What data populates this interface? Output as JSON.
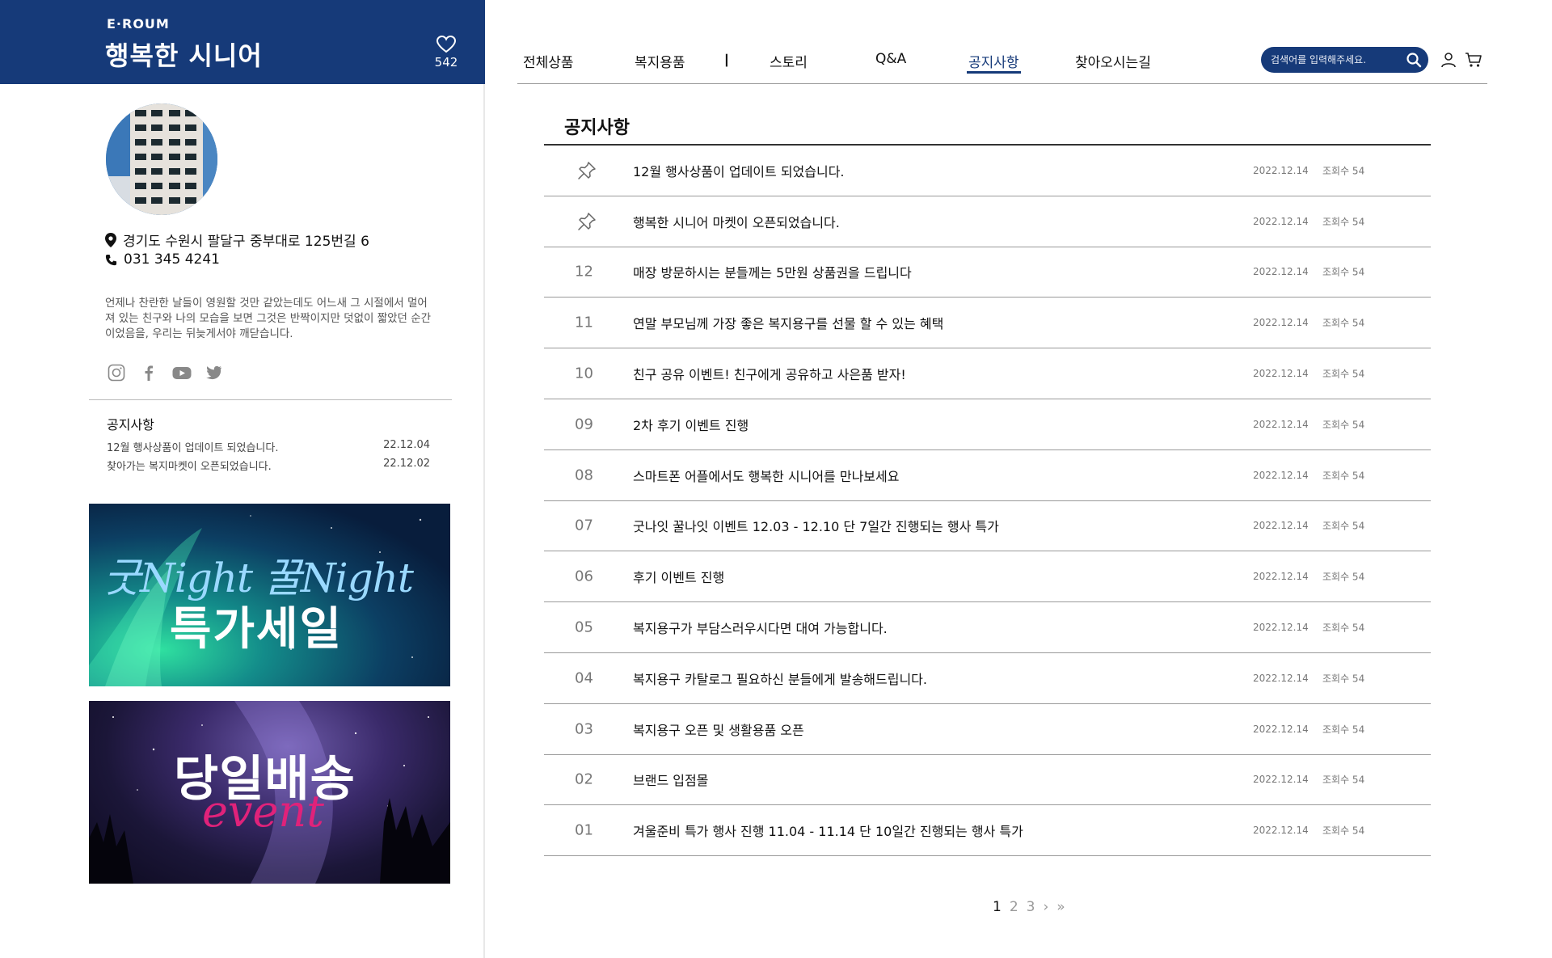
{
  "brand": {
    "logo": "E·ROUM",
    "title": "행복한 시니어",
    "like_count": "542"
  },
  "profile": {
    "address": "경기도 수원시 팔달구 중부대로 125번길 6",
    "phone": "031 345 4241",
    "about": "언제나 찬란한 날들이 영원할 것만 같았는데도 어느새 그 시절에서 멀어져 있는 친구와 나의 모습을 보면 그것은 반짝이지만 덧없이 짧았던 순간이었음을, 우리는 뒤늦게서야 깨닫습니다."
  },
  "side_notice": {
    "title": "공지사항",
    "items": [
      {
        "title": "12월 행사상품이 업데이트 되었습니다.",
        "date": "22.12.04"
      },
      {
        "title": "찾아가는 복지마켓이 오픈되었습니다.",
        "date": "22.12.02"
      }
    ]
  },
  "banners": {
    "night": {
      "script": "굿Night 꿀Night",
      "headline": "특가세일"
    },
    "delivery": {
      "headline": "당일배송",
      "script": "event"
    }
  },
  "nav": {
    "items": [
      "전체상품",
      "복지용품",
      "ㅣ",
      "스토리",
      "Q&A",
      "공지사항",
      "찾아오시는길"
    ],
    "active": "공지사항",
    "search_placeholder": "검색어를 입력해주세요."
  },
  "board": {
    "title": "공지사항",
    "rows": [
      {
        "num": "",
        "pinned": true,
        "title": "12월 행사상품이 업데이트 되었습니다.",
        "date": "2022.12.14",
        "views": "조회수 54"
      },
      {
        "num": "",
        "pinned": true,
        "title": "행복한 시니어 마켓이 오픈되었습니다.",
        "date": "2022.12.14",
        "views": "조회수 54"
      },
      {
        "num": "12",
        "pinned": false,
        "title": "매장 방문하시는 분들께는 5만원 상품권을 드립니다",
        "date": "2022.12.14",
        "views": "조회수 54"
      },
      {
        "num": "11",
        "pinned": false,
        "title": "연말 부모님께 가장 좋은 복지용구를 선물 할 수 있는 혜택",
        "date": "2022.12.14",
        "views": "조회수 54"
      },
      {
        "num": "10",
        "pinned": false,
        "title": "친구 공유 이벤트! 친구에게 공유하고 사은품 받자!",
        "date": "2022.12.14",
        "views": "조회수 54"
      },
      {
        "num": "09",
        "pinned": false,
        "title": "2차 후기 이벤트 진행",
        "date": "2022.12.14",
        "views": "조회수 54"
      },
      {
        "num": "08",
        "pinned": false,
        "title": "스마트폰 어플에서도 행복한 시니어를 만나보세요",
        "date": "2022.12.14",
        "views": "조회수 54"
      },
      {
        "num": "07",
        "pinned": false,
        "title": "굿나잇 꿀나잇 이벤트 12.03 - 12.10 단 7일간 진행되는 행사 특가",
        "date": "2022.12.14",
        "views": "조회수 54"
      },
      {
        "num": "06",
        "pinned": false,
        "title": "후기 이벤트 진행",
        "date": "2022.12.14",
        "views": "조회수 54"
      },
      {
        "num": "05",
        "pinned": false,
        "title": "복지용구가 부담스러우시다면 대여 가능합니다.",
        "date": "2022.12.14",
        "views": "조회수 54"
      },
      {
        "num": "04",
        "pinned": false,
        "title": "복지용구 카탈로그 필요하신 분들에게 발송해드립니다.",
        "date": "2022.12.14",
        "views": "조회수 54"
      },
      {
        "num": "03",
        "pinned": false,
        "title": "복지용구 오픈 및 생활용품 오픈",
        "date": "2022.12.14",
        "views": "조회수 54"
      },
      {
        "num": "02",
        "pinned": false,
        "title": "브랜드 입점몰",
        "date": "2022.12.14",
        "views": "조회수 54"
      },
      {
        "num": "01",
        "pinned": false,
        "title": "겨울준비 특가 행사 진행 11.04 - 11.14 단 10일간 진행되는 행사 특가",
        "date": "2022.12.14",
        "views": "조회수 54"
      }
    ]
  },
  "pagination": {
    "pages": [
      "1",
      "2",
      "3"
    ],
    "current": "1",
    "next": "›",
    "last": "»"
  },
  "colors": {
    "brand": "#163a79",
    "divider": "#9a9a9a"
  }
}
